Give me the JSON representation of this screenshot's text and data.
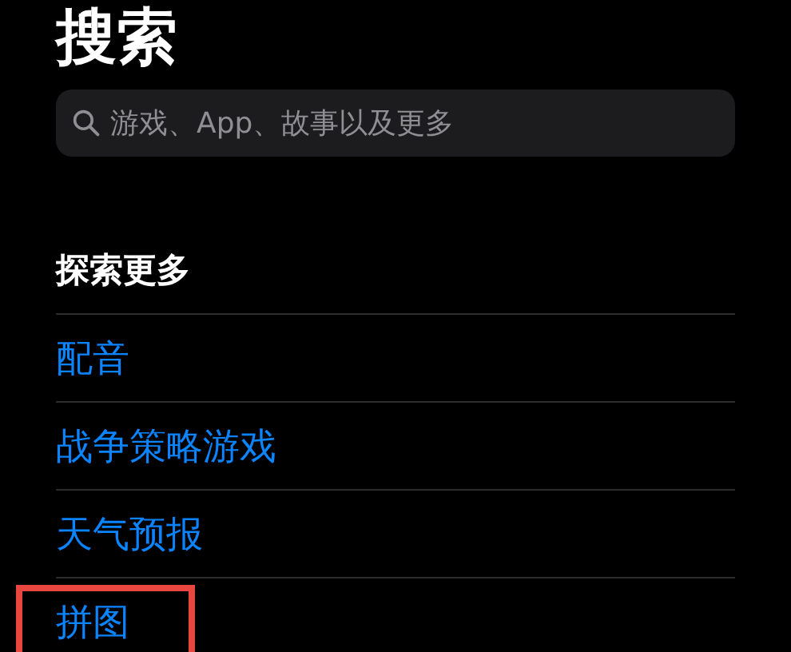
{
  "title": "搜索",
  "search": {
    "placeholder": "游戏、App、故事以及更多"
  },
  "section": {
    "title": "探索更多",
    "items": [
      {
        "label": "配音",
        "highlighted": false
      },
      {
        "label": "战争策略游戏",
        "highlighted": false
      },
      {
        "label": "天气预报",
        "highlighted": false
      },
      {
        "label": "拼图",
        "highlighted": true
      }
    ]
  }
}
